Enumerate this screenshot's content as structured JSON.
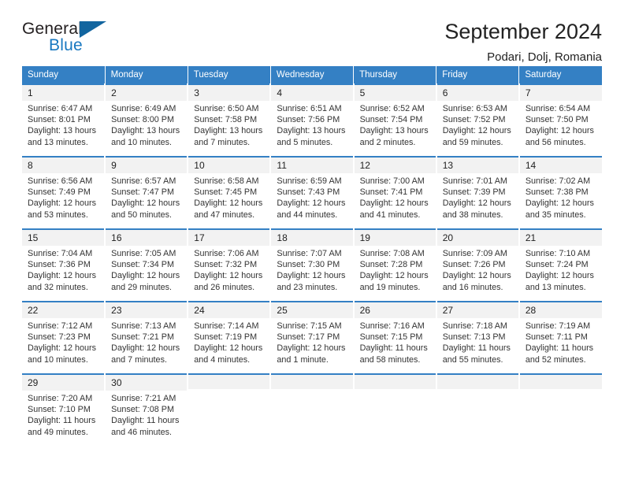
{
  "logo": {
    "word_one": "General",
    "word_two": "Blue",
    "triangle": "blue-triangle-icon"
  },
  "header": {
    "title": "September 2024",
    "subtitle": "Podari, Dolj, Romania"
  },
  "colors": {
    "header_blue": "#3480c4",
    "logo_blue": "#1878c0",
    "daynum_band": "#f2f2f2"
  },
  "weekdays": [
    "Sunday",
    "Monday",
    "Tuesday",
    "Wednesday",
    "Thursday",
    "Friday",
    "Saturday"
  ],
  "weeks": [
    [
      {
        "day": "1",
        "sunrise": "Sunrise: 6:47 AM",
        "sunset": "Sunset: 8:01 PM",
        "daylight_1": "Daylight: 13 hours",
        "daylight_2": "and 13 minutes."
      },
      {
        "day": "2",
        "sunrise": "Sunrise: 6:49 AM",
        "sunset": "Sunset: 8:00 PM",
        "daylight_1": "Daylight: 13 hours",
        "daylight_2": "and 10 minutes."
      },
      {
        "day": "3",
        "sunrise": "Sunrise: 6:50 AM",
        "sunset": "Sunset: 7:58 PM",
        "daylight_1": "Daylight: 13 hours",
        "daylight_2": "and 7 minutes."
      },
      {
        "day": "4",
        "sunrise": "Sunrise: 6:51 AM",
        "sunset": "Sunset: 7:56 PM",
        "daylight_1": "Daylight: 13 hours",
        "daylight_2": "and 5 minutes."
      },
      {
        "day": "5",
        "sunrise": "Sunrise: 6:52 AM",
        "sunset": "Sunset: 7:54 PM",
        "daylight_1": "Daylight: 13 hours",
        "daylight_2": "and 2 minutes."
      },
      {
        "day": "6",
        "sunrise": "Sunrise: 6:53 AM",
        "sunset": "Sunset: 7:52 PM",
        "daylight_1": "Daylight: 12 hours",
        "daylight_2": "and 59 minutes."
      },
      {
        "day": "7",
        "sunrise": "Sunrise: 6:54 AM",
        "sunset": "Sunset: 7:50 PM",
        "daylight_1": "Daylight: 12 hours",
        "daylight_2": "and 56 minutes."
      }
    ],
    [
      {
        "day": "8",
        "sunrise": "Sunrise: 6:56 AM",
        "sunset": "Sunset: 7:49 PM",
        "daylight_1": "Daylight: 12 hours",
        "daylight_2": "and 53 minutes."
      },
      {
        "day": "9",
        "sunrise": "Sunrise: 6:57 AM",
        "sunset": "Sunset: 7:47 PM",
        "daylight_1": "Daylight: 12 hours",
        "daylight_2": "and 50 minutes."
      },
      {
        "day": "10",
        "sunrise": "Sunrise: 6:58 AM",
        "sunset": "Sunset: 7:45 PM",
        "daylight_1": "Daylight: 12 hours",
        "daylight_2": "and 47 minutes."
      },
      {
        "day": "11",
        "sunrise": "Sunrise: 6:59 AM",
        "sunset": "Sunset: 7:43 PM",
        "daylight_1": "Daylight: 12 hours",
        "daylight_2": "and 44 minutes."
      },
      {
        "day": "12",
        "sunrise": "Sunrise: 7:00 AM",
        "sunset": "Sunset: 7:41 PM",
        "daylight_1": "Daylight: 12 hours",
        "daylight_2": "and 41 minutes."
      },
      {
        "day": "13",
        "sunrise": "Sunrise: 7:01 AM",
        "sunset": "Sunset: 7:39 PM",
        "daylight_1": "Daylight: 12 hours",
        "daylight_2": "and 38 minutes."
      },
      {
        "day": "14",
        "sunrise": "Sunrise: 7:02 AM",
        "sunset": "Sunset: 7:38 PM",
        "daylight_1": "Daylight: 12 hours",
        "daylight_2": "and 35 minutes."
      }
    ],
    [
      {
        "day": "15",
        "sunrise": "Sunrise: 7:04 AM",
        "sunset": "Sunset: 7:36 PM",
        "daylight_1": "Daylight: 12 hours",
        "daylight_2": "and 32 minutes."
      },
      {
        "day": "16",
        "sunrise": "Sunrise: 7:05 AM",
        "sunset": "Sunset: 7:34 PM",
        "daylight_1": "Daylight: 12 hours",
        "daylight_2": "and 29 minutes."
      },
      {
        "day": "17",
        "sunrise": "Sunrise: 7:06 AM",
        "sunset": "Sunset: 7:32 PM",
        "daylight_1": "Daylight: 12 hours",
        "daylight_2": "and 26 minutes."
      },
      {
        "day": "18",
        "sunrise": "Sunrise: 7:07 AM",
        "sunset": "Sunset: 7:30 PM",
        "daylight_1": "Daylight: 12 hours",
        "daylight_2": "and 23 minutes."
      },
      {
        "day": "19",
        "sunrise": "Sunrise: 7:08 AM",
        "sunset": "Sunset: 7:28 PM",
        "daylight_1": "Daylight: 12 hours",
        "daylight_2": "and 19 minutes."
      },
      {
        "day": "20",
        "sunrise": "Sunrise: 7:09 AM",
        "sunset": "Sunset: 7:26 PM",
        "daylight_1": "Daylight: 12 hours",
        "daylight_2": "and 16 minutes."
      },
      {
        "day": "21",
        "sunrise": "Sunrise: 7:10 AM",
        "sunset": "Sunset: 7:24 PM",
        "daylight_1": "Daylight: 12 hours",
        "daylight_2": "and 13 minutes."
      }
    ],
    [
      {
        "day": "22",
        "sunrise": "Sunrise: 7:12 AM",
        "sunset": "Sunset: 7:23 PM",
        "daylight_1": "Daylight: 12 hours",
        "daylight_2": "and 10 minutes."
      },
      {
        "day": "23",
        "sunrise": "Sunrise: 7:13 AM",
        "sunset": "Sunset: 7:21 PM",
        "daylight_1": "Daylight: 12 hours",
        "daylight_2": "and 7 minutes."
      },
      {
        "day": "24",
        "sunrise": "Sunrise: 7:14 AM",
        "sunset": "Sunset: 7:19 PM",
        "daylight_1": "Daylight: 12 hours",
        "daylight_2": "and 4 minutes."
      },
      {
        "day": "25",
        "sunrise": "Sunrise: 7:15 AM",
        "sunset": "Sunset: 7:17 PM",
        "daylight_1": "Daylight: 12 hours",
        "daylight_2": "and 1 minute."
      },
      {
        "day": "26",
        "sunrise": "Sunrise: 7:16 AM",
        "sunset": "Sunset: 7:15 PM",
        "daylight_1": "Daylight: 11 hours",
        "daylight_2": "and 58 minutes."
      },
      {
        "day": "27",
        "sunrise": "Sunrise: 7:18 AM",
        "sunset": "Sunset: 7:13 PM",
        "daylight_1": "Daylight: 11 hours",
        "daylight_2": "and 55 minutes."
      },
      {
        "day": "28",
        "sunrise": "Sunrise: 7:19 AM",
        "sunset": "Sunset: 7:11 PM",
        "daylight_1": "Daylight: 11 hours",
        "daylight_2": "and 52 minutes."
      }
    ],
    [
      {
        "day": "29",
        "sunrise": "Sunrise: 7:20 AM",
        "sunset": "Sunset: 7:10 PM",
        "daylight_1": "Daylight: 11 hours",
        "daylight_2": "and 49 minutes."
      },
      {
        "day": "30",
        "sunrise": "Sunrise: 7:21 AM",
        "sunset": "Sunset: 7:08 PM",
        "daylight_1": "Daylight: 11 hours",
        "daylight_2": "and 46 minutes."
      },
      {
        "day": "",
        "sunrise": "",
        "sunset": "",
        "daylight_1": "",
        "daylight_2": ""
      },
      {
        "day": "",
        "sunrise": "",
        "sunset": "",
        "daylight_1": "",
        "daylight_2": ""
      },
      {
        "day": "",
        "sunrise": "",
        "sunset": "",
        "daylight_1": "",
        "daylight_2": ""
      },
      {
        "day": "",
        "sunrise": "",
        "sunset": "",
        "daylight_1": "",
        "daylight_2": ""
      },
      {
        "day": "",
        "sunrise": "",
        "sunset": "",
        "daylight_1": "",
        "daylight_2": ""
      }
    ]
  ]
}
